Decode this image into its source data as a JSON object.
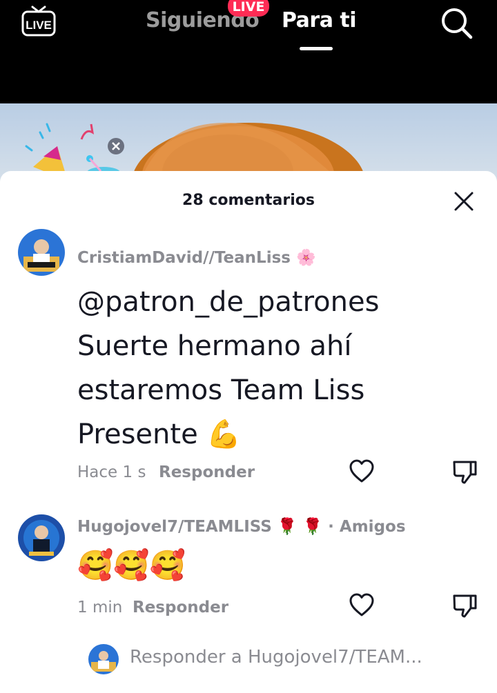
{
  "header": {
    "live_label": "LIVE",
    "tabs": [
      {
        "label": "Siguiendo"
      },
      {
        "label": "Para ti"
      }
    ],
    "live_badge": "LIVE"
  },
  "sheet": {
    "title": "28 comentarios"
  },
  "comments": [
    {
      "author": "CristiamDavid//TeanLiss 🌸",
      "text_lines": [
        "@patron_de_patrones",
        "Suerte hermano ahí",
        "estaremos Team Liss",
        "Presente 💪"
      ],
      "time": "Hace 1 s",
      "reply_label": "Responder"
    },
    {
      "author": "Hugojovel7/TEAMLISS 🌹 🌹",
      "friend_tag": "· Amigos",
      "text": "🥰🥰🥰",
      "time": "1 min",
      "reply_label": "Responder"
    }
  ],
  "reply_bar": {
    "placeholder": "Responder a Hugojovel7/TEAM..."
  },
  "colors": {
    "accent": "#fe2c55",
    "text_primary": "#161823",
    "text_secondary": "#8a8b91"
  }
}
